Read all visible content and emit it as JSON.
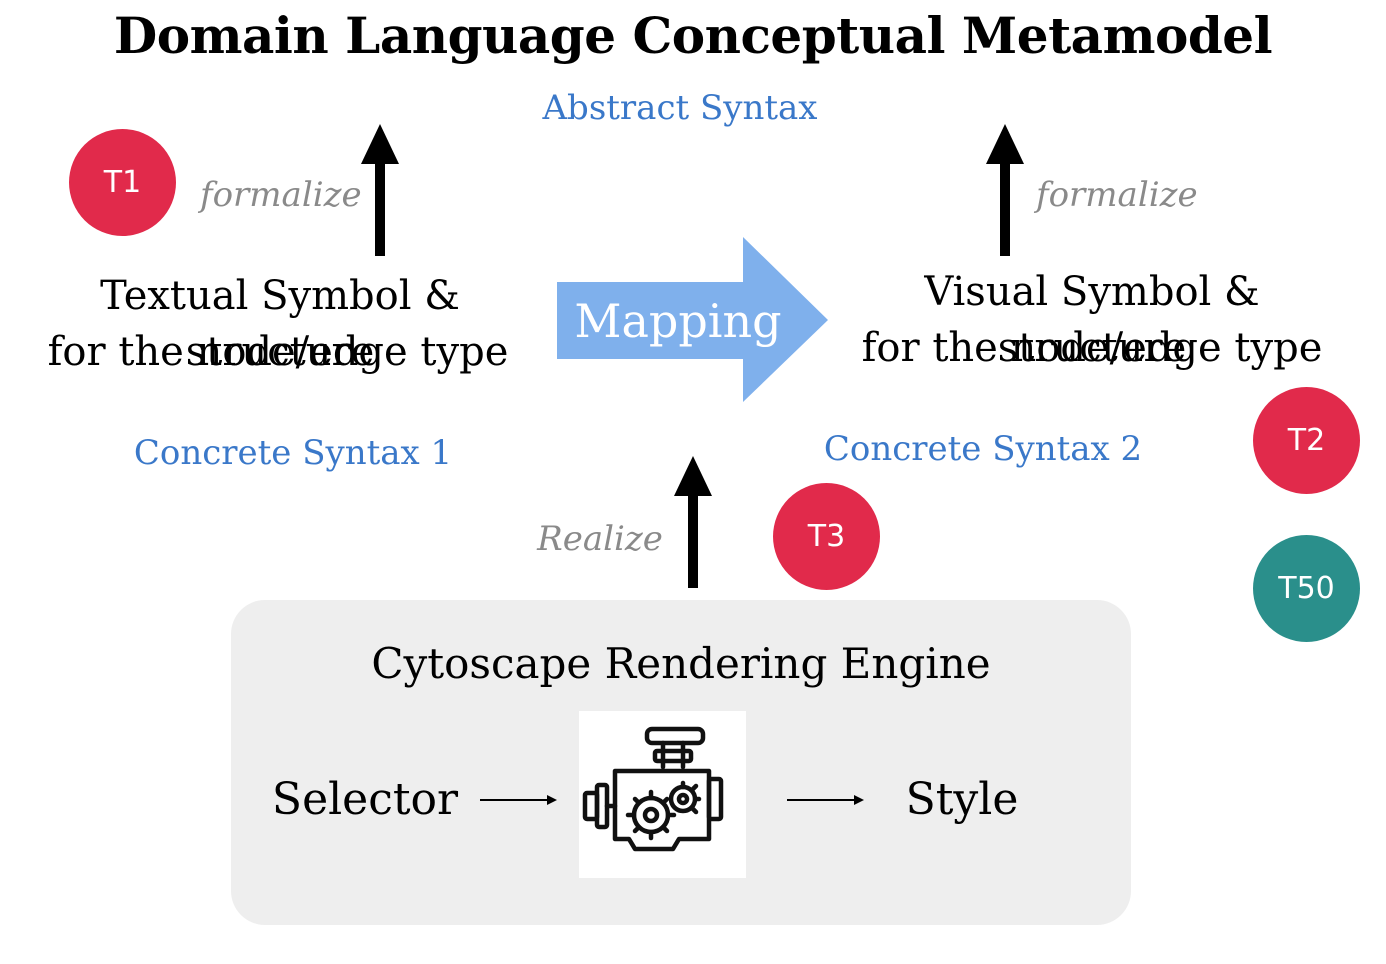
{
  "title": "Domain Language Conceptual Metamodel",
  "abstract_syntax": "Abstract Syntax",
  "left": {
    "badge": "T1",
    "arrow_label": "formalize",
    "symbol_line1": "Textual Symbol & structure",
    "symbol_line2": "for the node/edge type",
    "syntax_label": "Concrete Syntax 1"
  },
  "mapping": {
    "label": "Mapping",
    "color": "#7fb0ec"
  },
  "right": {
    "badge": "T2",
    "arrow_label": "formalize",
    "symbol_line1": "Visual Symbol & structure",
    "symbol_line2": "for the node/edge type",
    "syntax_label": "Concrete Syntax 2"
  },
  "realize": {
    "label": "Realize",
    "badge": "T3"
  },
  "extra_badge": "T50",
  "engine": {
    "title": "Cytoscape Rendering Engine",
    "input": "Selector",
    "output": "Style",
    "icon": "engine-gears-icon"
  },
  "colors": {
    "badge_red": "#e12a4b",
    "badge_teal": "#2a8f8b",
    "syntax_blue": "#3a78c9"
  }
}
